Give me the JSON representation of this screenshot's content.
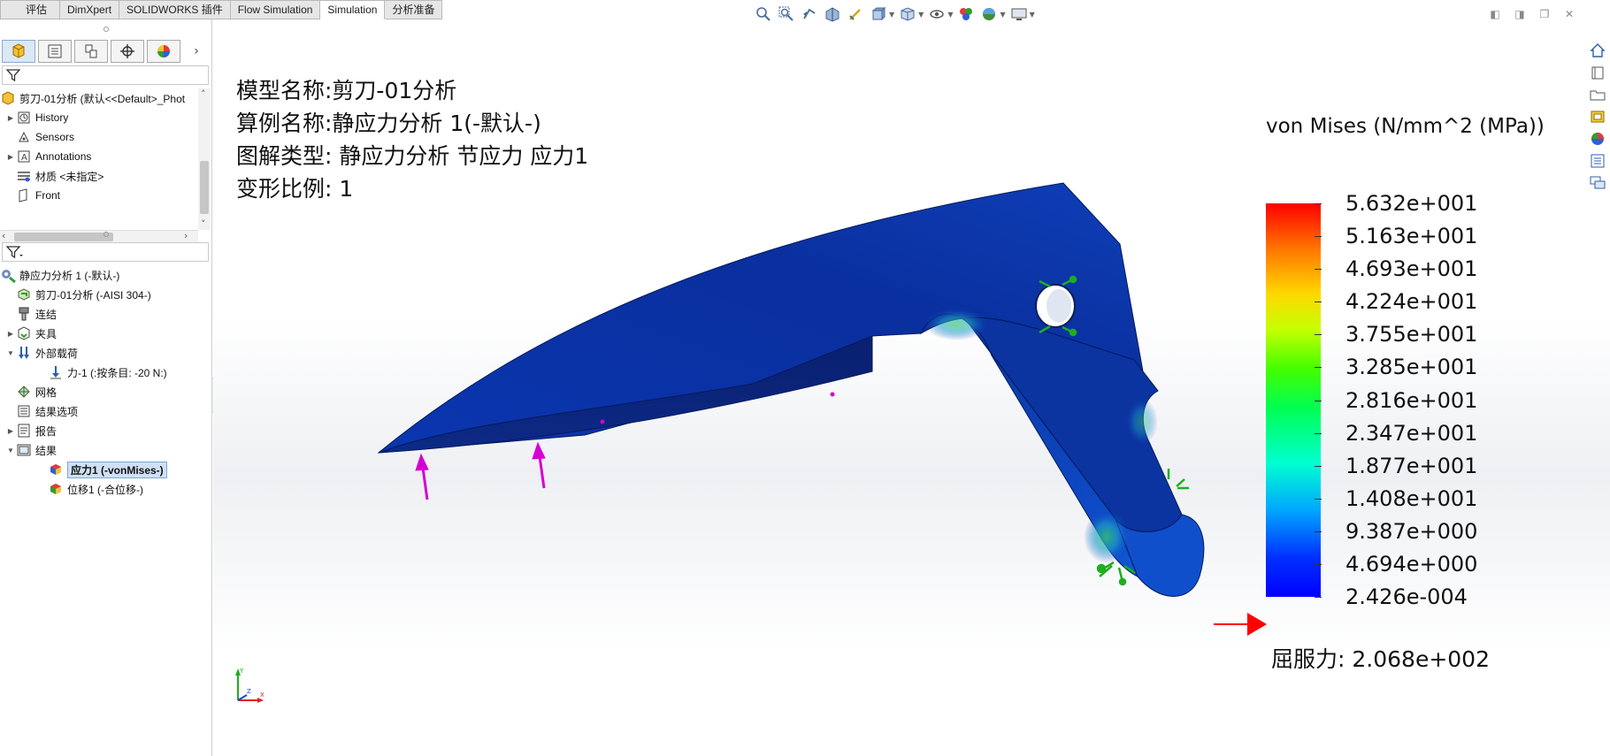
{
  "command_tabs": [
    {
      "label": "评估",
      "active": false
    },
    {
      "label": "DimXpert",
      "active": false
    },
    {
      "label": "SOLIDWORKS 插件",
      "active": false
    },
    {
      "label": "Flow Simulation",
      "active": false
    },
    {
      "label": "Simulation",
      "active": true
    },
    {
      "label": "分析准备",
      "active": false
    }
  ],
  "feature_tree": {
    "root_label": "剪刀-01分析  (默认<<Default>_Phot",
    "items": [
      {
        "label": "History",
        "icon": "history-icon",
        "expandable": true
      },
      {
        "label": "Sensors",
        "icon": "sensors-icon",
        "expandable": false
      },
      {
        "label": "Annotations",
        "icon": "annotations-icon",
        "expandable": true
      },
      {
        "label": "材质 <未指定>",
        "icon": "material-icon",
        "expandable": false
      },
      {
        "label": "Front",
        "icon": "plane-icon",
        "expandable": false
      }
    ]
  },
  "simulation_tree": {
    "study_label": "静应力分析 1 (-默认-)",
    "items": [
      {
        "label": "剪刀-01分析 (-AISI 304-)",
        "icon": "part-icon",
        "level": 1,
        "expander": ""
      },
      {
        "label": "连结",
        "icon": "connections-icon",
        "level": 1,
        "expander": ""
      },
      {
        "label": "夹具",
        "icon": "fixtures-icon",
        "level": 1,
        "expander": "▶"
      },
      {
        "label": "外部载荷",
        "icon": "external-loads-icon",
        "level": 1,
        "expander": "▼"
      },
      {
        "label": "力-1 (:按条目: -20 N:)",
        "icon": "force-icon",
        "level": 2,
        "expander": ""
      },
      {
        "label": "网格",
        "icon": "mesh-icon",
        "level": 1,
        "expander": ""
      },
      {
        "label": "结果选项",
        "icon": "result-options-icon",
        "level": 1,
        "expander": ""
      },
      {
        "label": "报告",
        "icon": "report-icon",
        "level": 1,
        "expander": "▶"
      },
      {
        "label": "结果",
        "icon": "results-icon",
        "level": 1,
        "expander": "▼"
      },
      {
        "label": "应力1 (-vonMises-)",
        "icon": "stress-plot-icon",
        "level": 2,
        "expander": "",
        "selected": true
      },
      {
        "label": "位移1 (-合位移-)",
        "icon": "displacement-plot-icon",
        "level": 2,
        "expander": ""
      }
    ]
  },
  "model_info": {
    "model_name": "模型名称:剪刀-01分析",
    "study_name": "算例名称:静应力分析 1(-默认-)",
    "plot_type": "图解类型: 静应力分析 节应力 应力1",
    "deformation_scale": "变形比例: 1"
  },
  "legend": {
    "title": "von Mises (N/mm^2 (MPa))",
    "values": [
      "5.632e+001",
      "5.163e+001",
      "4.693e+001",
      "4.224e+001",
      "3.755e+001",
      "3.285e+001",
      "2.816e+001",
      "2.347e+001",
      "1.877e+001",
      "1.408e+001",
      "9.387e+000",
      "4.694e+000",
      "2.426e-004"
    ],
    "yield_strength": "屈服力: 2.068e+002",
    "max_color": "#ff0000",
    "min_color": "#0000ff"
  },
  "triad": {
    "y_label": "Y",
    "x_label": "X",
    "z_label": "Z"
  },
  "colors": {
    "accent": "#cfe0f5",
    "model_base": "#0a2aa8",
    "load_arrow": "#d400d4",
    "fixture": "#1fae1f"
  }
}
